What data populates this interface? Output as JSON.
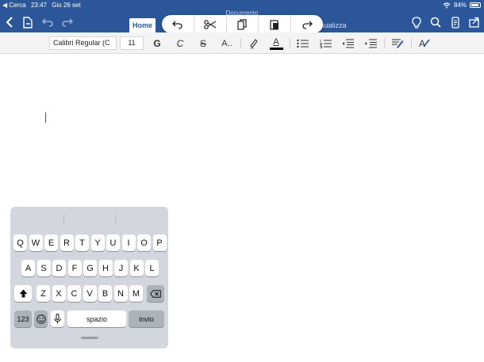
{
  "status_bar": {
    "back_app": "◀ Cerca",
    "time": "23:47",
    "date": "Gio 26 set",
    "battery": "84%"
  },
  "title_bar": {
    "document_title": "Documento",
    "tabs": [
      {
        "label": "Home",
        "active": true
      },
      {
        "label": "Visualizza",
        "active": false
      }
    ],
    "visible_tab_text": "isualizza",
    "edit_menu": [
      "undo",
      "cut",
      "copy",
      "paste",
      "redo"
    ],
    "right_icons": [
      "lightbulb-icon",
      "search-icon",
      "phone-view-icon",
      "share-icon"
    ]
  },
  "ribbon": {
    "font_name": "Calibri Regular (C",
    "font_size": "11",
    "bold": "G",
    "italic": "C",
    "strikethrough": "S",
    "format_more": "A..",
    "font_color_label": "A",
    "styles_label": "A"
  },
  "keyboard": {
    "rows": [
      [
        "Q",
        "W",
        "E",
        "R",
        "T",
        "Y",
        "U",
        "I",
        "O",
        "P"
      ],
      [
        "A",
        "S",
        "D",
        "F",
        "G",
        "H",
        "J",
        "K",
        "L"
      ],
      [
        "Z",
        "X",
        "C",
        "V",
        "B",
        "N",
        "M"
      ]
    ],
    "numbers_key": "123",
    "space_key": "spazio",
    "return_key": "invio"
  },
  "colors": {
    "brand": "#2b579a",
    "ribbon_bg": "#f3f3f3",
    "keyboard_bg": "#d3d6dc"
  }
}
